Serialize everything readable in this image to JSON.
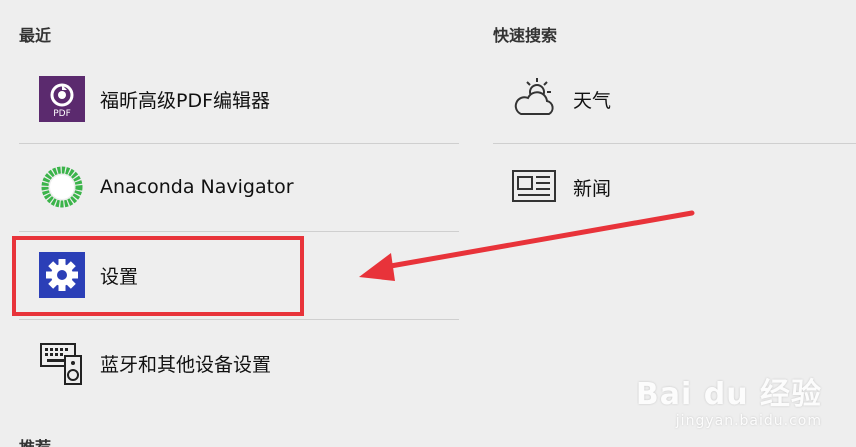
{
  "sections": {
    "recent": "最近",
    "quick_search": "快速搜索",
    "more": "推荐"
  },
  "recent_items": [
    {
      "label": "福昕高级PDF编辑器",
      "icon": "foxit-pdf-icon",
      "icon_text": "PDF"
    },
    {
      "label": "Anaconda Navigator",
      "icon": "anaconda-icon"
    },
    {
      "label": "设置",
      "icon": "gear-icon"
    },
    {
      "label": "蓝牙和其他设备设置",
      "icon": "devices-icon"
    }
  ],
  "quick_items": [
    {
      "label": "天气",
      "icon": "weather-icon"
    },
    {
      "label": "新闻",
      "icon": "news-icon"
    }
  ],
  "watermark": {
    "logo": "Bai du 经验",
    "url": "jingyan.baidu.com"
  },
  "colors": {
    "background": "#eeeeee",
    "highlight": "#e8333a",
    "foxit_purple": "#5b2a6e",
    "anaconda_green": "#3bb44a",
    "settings_blue": "#2b3fb7"
  }
}
